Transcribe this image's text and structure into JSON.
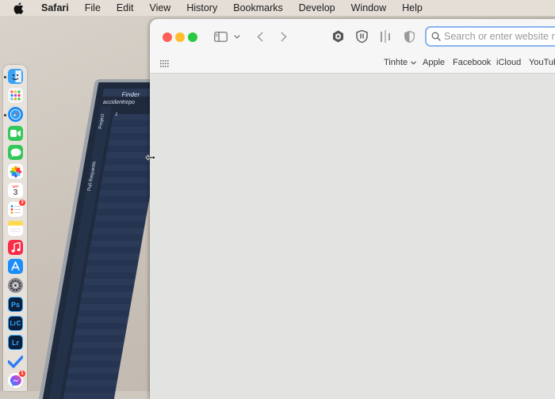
{
  "menubar": {
    "items": [
      "Safari",
      "File",
      "Edit",
      "View",
      "History",
      "Bookmarks",
      "Develop",
      "Window",
      "Help"
    ]
  },
  "background_laptop": {
    "finder_label": "Finder",
    "folder_text": "accidentrepo",
    "sidebar_text": "Project",
    "sidebar_text2": "Pull Requests",
    "row_number": "1"
  },
  "dock": {
    "items": [
      {
        "name": "finder",
        "color": "#3ba3f5"
      },
      {
        "name": "launchpad",
        "color": "#f6f6f6"
      },
      {
        "name": "safari",
        "color": "#1e8df2"
      },
      {
        "name": "facetime",
        "color": "#34c759"
      },
      {
        "name": "messages",
        "color": "#34c759"
      },
      {
        "name": "photos",
        "color": "#ffffff"
      },
      {
        "name": "calendar",
        "color": "#ffffff",
        "month": "SEP",
        "day": "3"
      },
      {
        "name": "reminders",
        "color": "#ffffff",
        "badge": "3"
      },
      {
        "name": "notes",
        "color": "#ffd952"
      },
      {
        "name": "music",
        "color": "#fa2d48"
      },
      {
        "name": "app-store",
        "color": "#1c8ef9"
      },
      {
        "name": "system-settings",
        "color": "#8e8e93"
      },
      {
        "name": "photoshop",
        "color": "#0b1f3a",
        "label": "Ps"
      },
      {
        "name": "lightroom-classic",
        "color": "#0b1f3a",
        "label": "LrC"
      },
      {
        "name": "lightroom",
        "color": "#0b1f3a",
        "label": "Lr"
      },
      {
        "name": "todo",
        "color": "#2f7cf6"
      },
      {
        "name": "messenger",
        "color": "#a44cf0",
        "badge": "1"
      }
    ]
  },
  "safari": {
    "address_placeholder": "Search or enter website name",
    "favorites": [
      {
        "label": "Tinhte",
        "has_menu": true
      },
      {
        "label": "Apple"
      },
      {
        "label": "Facebook"
      },
      {
        "label": "iCloud"
      },
      {
        "label": "YouTube"
      }
    ]
  },
  "colors": {
    "close": "#fe5f57",
    "minimize": "#febc2e",
    "zoom": "#28c840",
    "focus_ring": "#8ab4f0"
  }
}
